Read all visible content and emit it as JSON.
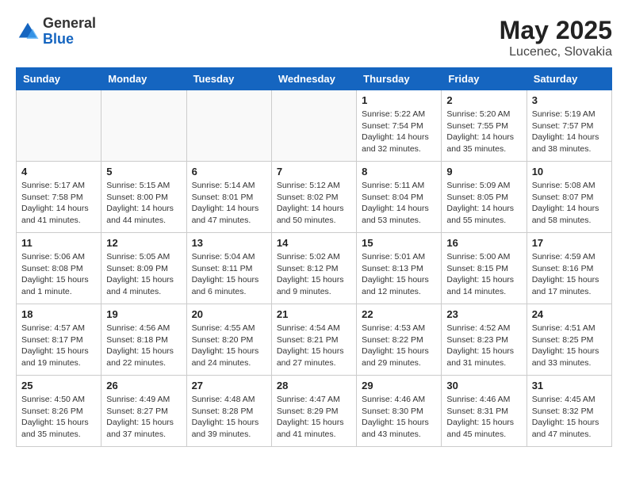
{
  "header": {
    "logo_general": "General",
    "logo_blue": "Blue",
    "main_title": "May 2025",
    "subtitle": "Lucenec, Slovakia"
  },
  "weekdays": [
    "Sunday",
    "Monday",
    "Tuesday",
    "Wednesday",
    "Thursday",
    "Friday",
    "Saturday"
  ],
  "weeks": [
    [
      {
        "day": "",
        "info": ""
      },
      {
        "day": "",
        "info": ""
      },
      {
        "day": "",
        "info": ""
      },
      {
        "day": "",
        "info": ""
      },
      {
        "day": "1",
        "info": "Sunrise: 5:22 AM\nSunset: 7:54 PM\nDaylight: 14 hours\nand 32 minutes."
      },
      {
        "day": "2",
        "info": "Sunrise: 5:20 AM\nSunset: 7:55 PM\nDaylight: 14 hours\nand 35 minutes."
      },
      {
        "day": "3",
        "info": "Sunrise: 5:19 AM\nSunset: 7:57 PM\nDaylight: 14 hours\nand 38 minutes."
      }
    ],
    [
      {
        "day": "4",
        "info": "Sunrise: 5:17 AM\nSunset: 7:58 PM\nDaylight: 14 hours\nand 41 minutes."
      },
      {
        "day": "5",
        "info": "Sunrise: 5:15 AM\nSunset: 8:00 PM\nDaylight: 14 hours\nand 44 minutes."
      },
      {
        "day": "6",
        "info": "Sunrise: 5:14 AM\nSunset: 8:01 PM\nDaylight: 14 hours\nand 47 minutes."
      },
      {
        "day": "7",
        "info": "Sunrise: 5:12 AM\nSunset: 8:02 PM\nDaylight: 14 hours\nand 50 minutes."
      },
      {
        "day": "8",
        "info": "Sunrise: 5:11 AM\nSunset: 8:04 PM\nDaylight: 14 hours\nand 53 minutes."
      },
      {
        "day": "9",
        "info": "Sunrise: 5:09 AM\nSunset: 8:05 PM\nDaylight: 14 hours\nand 55 minutes."
      },
      {
        "day": "10",
        "info": "Sunrise: 5:08 AM\nSunset: 8:07 PM\nDaylight: 14 hours\nand 58 minutes."
      }
    ],
    [
      {
        "day": "11",
        "info": "Sunrise: 5:06 AM\nSunset: 8:08 PM\nDaylight: 15 hours\nand 1 minute."
      },
      {
        "day": "12",
        "info": "Sunrise: 5:05 AM\nSunset: 8:09 PM\nDaylight: 15 hours\nand 4 minutes."
      },
      {
        "day": "13",
        "info": "Sunrise: 5:04 AM\nSunset: 8:11 PM\nDaylight: 15 hours\nand 6 minutes."
      },
      {
        "day": "14",
        "info": "Sunrise: 5:02 AM\nSunset: 8:12 PM\nDaylight: 15 hours\nand 9 minutes."
      },
      {
        "day": "15",
        "info": "Sunrise: 5:01 AM\nSunset: 8:13 PM\nDaylight: 15 hours\nand 12 minutes."
      },
      {
        "day": "16",
        "info": "Sunrise: 5:00 AM\nSunset: 8:15 PM\nDaylight: 15 hours\nand 14 minutes."
      },
      {
        "day": "17",
        "info": "Sunrise: 4:59 AM\nSunset: 8:16 PM\nDaylight: 15 hours\nand 17 minutes."
      }
    ],
    [
      {
        "day": "18",
        "info": "Sunrise: 4:57 AM\nSunset: 8:17 PM\nDaylight: 15 hours\nand 19 minutes."
      },
      {
        "day": "19",
        "info": "Sunrise: 4:56 AM\nSunset: 8:18 PM\nDaylight: 15 hours\nand 22 minutes."
      },
      {
        "day": "20",
        "info": "Sunrise: 4:55 AM\nSunset: 8:20 PM\nDaylight: 15 hours\nand 24 minutes."
      },
      {
        "day": "21",
        "info": "Sunrise: 4:54 AM\nSunset: 8:21 PM\nDaylight: 15 hours\nand 27 minutes."
      },
      {
        "day": "22",
        "info": "Sunrise: 4:53 AM\nSunset: 8:22 PM\nDaylight: 15 hours\nand 29 minutes."
      },
      {
        "day": "23",
        "info": "Sunrise: 4:52 AM\nSunset: 8:23 PM\nDaylight: 15 hours\nand 31 minutes."
      },
      {
        "day": "24",
        "info": "Sunrise: 4:51 AM\nSunset: 8:25 PM\nDaylight: 15 hours\nand 33 minutes."
      }
    ],
    [
      {
        "day": "25",
        "info": "Sunrise: 4:50 AM\nSunset: 8:26 PM\nDaylight: 15 hours\nand 35 minutes."
      },
      {
        "day": "26",
        "info": "Sunrise: 4:49 AM\nSunset: 8:27 PM\nDaylight: 15 hours\nand 37 minutes."
      },
      {
        "day": "27",
        "info": "Sunrise: 4:48 AM\nSunset: 8:28 PM\nDaylight: 15 hours\nand 39 minutes."
      },
      {
        "day": "28",
        "info": "Sunrise: 4:47 AM\nSunset: 8:29 PM\nDaylight: 15 hours\nand 41 minutes."
      },
      {
        "day": "29",
        "info": "Sunrise: 4:46 AM\nSunset: 8:30 PM\nDaylight: 15 hours\nand 43 minutes."
      },
      {
        "day": "30",
        "info": "Sunrise: 4:46 AM\nSunset: 8:31 PM\nDaylight: 15 hours\nand 45 minutes."
      },
      {
        "day": "31",
        "info": "Sunrise: 4:45 AM\nSunset: 8:32 PM\nDaylight: 15 hours\nand 47 minutes."
      }
    ]
  ]
}
